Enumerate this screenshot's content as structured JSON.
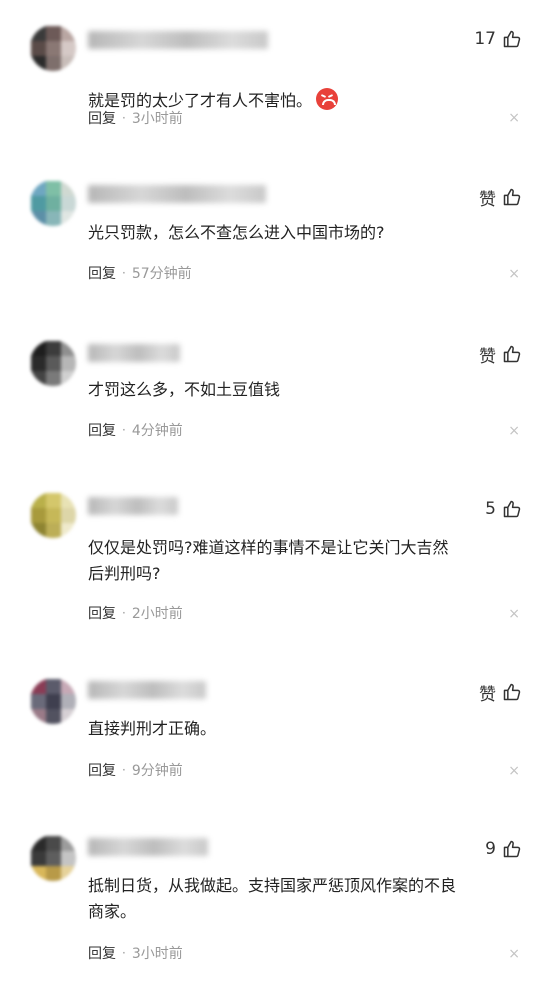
{
  "comments": [
    {
      "like": "17",
      "text": "就是罚的太少了才有人不害怕。",
      "has_emoji": true,
      "emoji": "angry-face-icon",
      "reply": "回复",
      "time": "3小时前",
      "close": "×",
      "avatar_colors": [
        "#3a3a3a",
        "#6d5a58",
        "#b9a6a2",
        "#5a4b48",
        "#8a7874",
        "#d5c9c6",
        "#2b2b2b",
        "#7e6f6c",
        "#c8bdb9"
      ]
    },
    {
      "like": "赞",
      "text": "光只罚款，怎么不查怎么进入中国市场的?",
      "reply": "回复",
      "time": "57分钟前",
      "close": "×",
      "avatar_colors": [
        "#6fa7c1",
        "#7fbfa6",
        "#d0d9d2",
        "#4f9aa2",
        "#6fb0a0",
        "#c9d8d6",
        "#5c8fa7",
        "#88b6b8",
        "#e0e6e3"
      ]
    },
    {
      "like": "赞",
      "text": "才罚这么多，不如土豆值钱",
      "reply": "回复",
      "time": "4分钟前",
      "close": "×",
      "avatar_colors": [
        "#1e1e1e",
        "#3c3c3c",
        "#8f8f8f",
        "#2a2a2a",
        "#5a5a5a",
        "#b6b6b6",
        "#444",
        "#7a7a7a",
        "#d0d0d0"
      ]
    },
    {
      "like": "5",
      "text": "仅仅是处罚吗?难道这样的事情不是让它关门大吉然\n后判刑吗?",
      "reply": "回复",
      "time": "2小时前",
      "close": "×",
      "avatar_colors": [
        "#b9b04a",
        "#d4c76b",
        "#e8e2b5",
        "#a89a3c",
        "#c6b858",
        "#ddd6a8",
        "#8e8431",
        "#bcae57",
        "#efeacc"
      ]
    },
    {
      "like": "赞",
      "text": "直接判刑才正确。",
      "reply": "回复",
      "time": "9分钟前",
      "close": "×",
      "avatar_colors": [
        "#8a3c55",
        "#5b5b6b",
        "#c7a9b6",
        "#6a6a7a",
        "#3f3f4f",
        "#b0b0b8",
        "#9a7b88",
        "#525260",
        "#d6d0d4"
      ]
    },
    {
      "like": "9",
      "text": "抵制日货，从我做起。支持国家严惩顶风作案的不良\n商家。",
      "reply": "回复",
      "time": "3小时前",
      "close": "×",
      "avatar_colors": [
        "#2a2a2a",
        "#4a4a4a",
        "#9c9c9c",
        "#3a3a3a",
        "#5e5e5e",
        "#c4c4c4",
        "#d9b75a",
        "#b89a48",
        "#e6d29a"
      ]
    }
  ]
}
